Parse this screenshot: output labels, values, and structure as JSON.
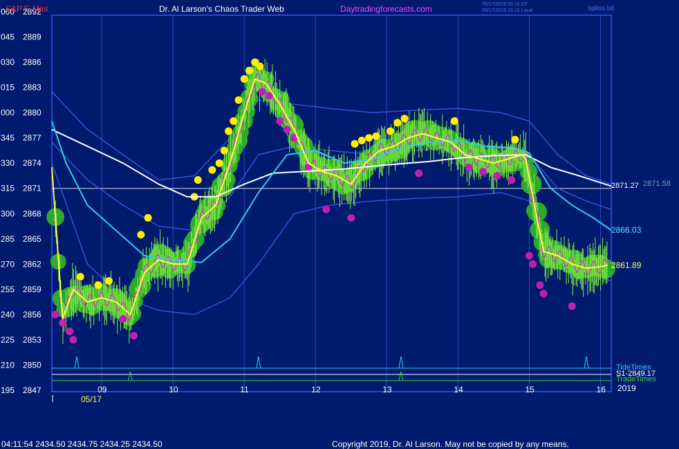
{
  "header": {
    "symbol": "S&P E-Mini",
    "title": "Dr. Al Larson's Chaos Trader Web",
    "site": "Daytradingforecasts.com",
    "ts_utc": "05/17/2019 20:16 UT",
    "ts_local": "05/17/2019 15:16 Local",
    "file": "spliss.txt"
  },
  "footer": {
    "quote": "04:11:54  2434.50  2434.75  2434.25  2434.50",
    "copyright": "Copyright 2019, Dr. Al Larson. May not be copied by any means."
  },
  "colors": {
    "background": "#001a6e",
    "grid": "#2b49c9",
    "price_line": "#ffff44",
    "sma_cyan": "#33ccee",
    "sma_white": "#ffffff",
    "band": "#3a4fd8",
    "green_dots": "#2ea82e",
    "yellow_dots": "#ffee00",
    "magenta_dots": "#c020b0",
    "label_text": "#ffffff",
    "red_text": "#ff3030",
    "magenta_text": "#ff33ff"
  },
  "chart_data": {
    "type": "line",
    "title": "S&P E-Mini",
    "date_label": "05/17",
    "year_label": "2019",
    "x_ticks": [
      "09",
      "10",
      "11",
      "12",
      "13",
      "14",
      "15",
      "16"
    ],
    "x_range": [
      8.3,
      16.15
    ],
    "y_range": [
      2847,
      2893
    ],
    "y_ticks": [
      {
        "angle": "195",
        "price": 2847
      },
      {
        "angle": "210",
        "price": 2850
      },
      {
        "angle": "225",
        "price": 2853
      },
      {
        "angle": "240",
        "price": 2856
      },
      {
        "angle": "255",
        "price": 2859
      },
      {
        "angle": "270",
        "price": 2862
      },
      {
        "angle": "285",
        "price": 2865
      },
      {
        "angle": "300",
        "price": 2868
      },
      {
        "angle": "315",
        "price": 2871
      },
      {
        "angle": "330",
        "price": 2874
      },
      {
        "angle": "345",
        "price": 2877
      },
      {
        "angle": "000",
        "price": 2880
      },
      {
        "angle": "015",
        "price": 2883
      },
      {
        "angle": "030",
        "price": 2886
      },
      {
        "angle": "045",
        "price": 2889
      },
      {
        "angle": "060",
        "price": 2892
      }
    ],
    "price": {
      "x": [
        8.3,
        8.45,
        8.6,
        8.8,
        9.0,
        9.2,
        9.4,
        9.6,
        9.8,
        10.0,
        10.2,
        10.4,
        10.6,
        10.8,
        11.0,
        11.15,
        11.3,
        11.5,
        11.7,
        11.9,
        12.1,
        12.3,
        12.5,
        12.7,
        12.9,
        13.1,
        13.3,
        13.5,
        13.7,
        13.9,
        14.1,
        14.3,
        14.5,
        14.7,
        14.9,
        14.95,
        15.05,
        15.2,
        15.4,
        15.6,
        15.8,
        16.0,
        16.1
      ],
      "y": [
        2873.5,
        2855.5,
        2859.0,
        2857.5,
        2858.0,
        2857.5,
        2856.0,
        2861.0,
        2862.5,
        2862.0,
        2862.0,
        2867.5,
        2869.0,
        2874.0,
        2880.0,
        2884.0,
        2883.5,
        2881.0,
        2878.0,
        2874.0,
        2873.0,
        2872.5,
        2871.5,
        2874.0,
        2875.5,
        2876.0,
        2877.0,
        2877.5,
        2877.0,
        2876.5,
        2875.0,
        2874.5,
        2874.0,
        2874.5,
        2875.0,
        2874.5,
        2870.0,
        2863.5,
        2863.0,
        2862.0,
        2861.5,
        2861.7,
        2861.89
      ]
    },
    "sma_cyan": {
      "x": [
        8.3,
        8.5,
        8.8,
        9.2,
        9.6,
        10.0,
        10.4,
        10.8,
        11.2,
        11.6,
        12.0,
        12.4,
        12.8,
        13.2,
        13.6,
        14.0,
        14.4,
        14.8,
        15.0,
        15.3,
        15.6,
        15.9,
        16.15
      ],
      "y": [
        2879.0,
        2874.0,
        2869.0,
        2866.0,
        2863.0,
        2862.5,
        2862.2,
        2865.0,
        2870.5,
        2875.0,
        2875.5,
        2874.0,
        2874.5,
        2875.8,
        2876.5,
        2876.7,
        2876.0,
        2875.8,
        2875.2,
        2871.0,
        2869.0,
        2867.5,
        2866.03
      ]
    },
    "sma_white": {
      "x": [
        8.3,
        8.8,
        9.3,
        9.8,
        10.2,
        10.6,
        11.0,
        11.4,
        11.8,
        12.4,
        13.0,
        13.6,
        14.0,
        14.5,
        14.95,
        15.3,
        15.7,
        16.15
      ],
      "y": [
        2878.0,
        2876.0,
        2874.0,
        2871.5,
        2870.0,
        2870.0,
        2871.5,
        2872.8,
        2873.0,
        2873.3,
        2873.8,
        2874.2,
        2874.6,
        2874.9,
        2875.0,
        2873.5,
        2872.5,
        2871.27
      ]
    },
    "band_upper": {
      "x": [
        8.3,
        8.8,
        9.3,
        9.8,
        10.3,
        10.8,
        11.2,
        11.7,
        12.2,
        12.8,
        13.4,
        14.0,
        14.6,
        15.0,
        15.4,
        15.8,
        16.15
      ],
      "y": [
        2882.5,
        2878.0,
        2875.0,
        2872.0,
        2872.5,
        2877.0,
        2881.5,
        2881.0,
        2880.5,
        2880.0,
        2880.3,
        2880.5,
        2880.0,
        2879.0,
        2875.0,
        2872.5,
        2871.5
      ]
    },
    "band_lower": {
      "x": [
        8.3,
        8.8,
        9.3,
        9.8,
        10.3,
        10.8,
        11.2,
        11.7,
        12.2,
        12.8,
        13.4,
        14.0,
        14.6,
        15.0,
        15.4,
        15.8,
        16.15
      ],
      "y": [
        2874.0,
        2862.0,
        2858.0,
        2856.5,
        2856.0,
        2858.0,
        2862.0,
        2868.0,
        2869.0,
        2869.5,
        2869.8,
        2870.0,
        2870.5,
        2869.5,
        2864.0,
        2861.0,
        2860.0
      ]
    },
    "band_upper2": {
      "x": [
        8.3,
        8.8,
        9.3,
        9.8,
        10.3,
        10.8,
        11.2,
        11.7,
        12.2,
        12.8,
        13.4,
        14.0,
        14.6,
        15.0,
        15.4,
        15.8,
        16.15
      ],
      "y": [
        2876.5,
        2872.0,
        2869.0,
        2866.5,
        2866.0,
        2870.0,
        2875.0,
        2876.0,
        2875.5,
        2875.0,
        2875.5,
        2876.0,
        2875.8,
        2875.0,
        2871.0,
        2869.5,
        2868.5
      ]
    },
    "yellow_dots": {
      "x": [
        8.7,
        8.95,
        9.1,
        9.55,
        9.65,
        10.3,
        10.35,
        10.55,
        10.65,
        10.72,
        10.78,
        10.85,
        10.92,
        11.0,
        11.07,
        11.15,
        11.22,
        12.55,
        12.65,
        12.75,
        12.85,
        13.05,
        13.15,
        13.25,
        13.95,
        14.8
      ],
      "y": [
        2860.5,
        2859.5,
        2860.0,
        2865.5,
        2867.5,
        2870.0,
        2872.0,
        2873.2,
        2874.0,
        2875.5,
        2877.8,
        2879.0,
        2881.5,
        2884.0,
        2885.0,
        2886.0,
        2885.5,
        2876.3,
        2876.7,
        2877.0,
        2877.2,
        2877.8,
        2878.8,
        2879.3,
        2879.0,
        2876.8
      ]
    },
    "magenta_dots": {
      "x": [
        8.35,
        8.45,
        8.55,
        8.6,
        9.3,
        9.45,
        11.25,
        11.35,
        11.5,
        11.6,
        11.7,
        11.9,
        12.15,
        12.5,
        13.45,
        14.15,
        14.35,
        14.55,
        14.75,
        15.0,
        15.05,
        15.15,
        15.2,
        15.6
      ],
      "y": [
        2856.0,
        2855.0,
        2854.0,
        2853.0,
        2855.5,
        2853.5,
        2882.5,
        2882.0,
        2879.0,
        2878.0,
        2877.0,
        2873.5,
        2868.5,
        2867.5,
        2872.8,
        2873.5,
        2873.0,
        2872.5,
        2872.0,
        2863.0,
        2862.0,
        2859.5,
        2858.5,
        2857.0
      ]
    },
    "right_labels": {
      "white_sma": "2871.27",
      "white_sma_ghost": "2871.58",
      "cyan_sma": "2866.03",
      "price_last": "2861.89"
    },
    "tide_times_label": "TideTimes",
    "s1_label": "S1-2849.17",
    "trade_times_label": "TradeTimes",
    "tide_spikes": [
      8.65,
      11.2,
      13.2,
      15.8
    ],
    "trade_spikes": [
      9.4,
      13.2
    ],
    "s1_price": 2849.17
  }
}
